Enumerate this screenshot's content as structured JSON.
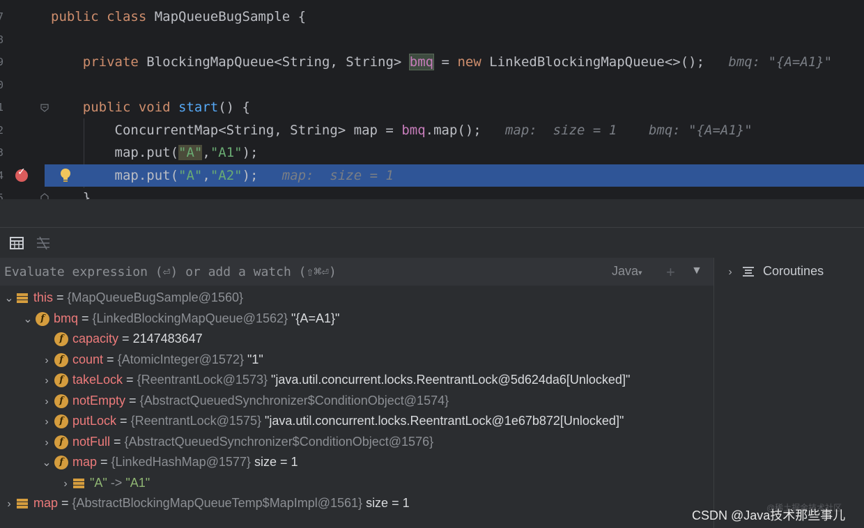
{
  "editor": {
    "lines": [
      {
        "num": "7",
        "parts": [
          {
            "t": "public class ",
            "c": "kw"
          },
          {
            "t": "MapQueueBugSample {",
            "c": ""
          }
        ]
      },
      {
        "num": "8",
        "parts": []
      },
      {
        "num": "9",
        "parts": [
          {
            "t": "    private ",
            "c": "kw"
          },
          {
            "t": "BlockingMapQueue<String, String> ",
            "c": ""
          },
          {
            "t": "bmq",
            "c": "fld box"
          },
          {
            "t": " = ",
            "c": ""
          },
          {
            "t": "new ",
            "c": "kw"
          },
          {
            "t": "LinkedBlockingMapQueue<>();",
            "c": ""
          },
          {
            "t": "   bmq: \"{A=A1}\"",
            "c": "hint"
          }
        ]
      },
      {
        "num": "0",
        "parts": []
      },
      {
        "num": "1",
        "parts": [
          {
            "t": "    public void ",
            "c": "kw"
          },
          {
            "t": "start",
            "c": "fn"
          },
          {
            "t": "() {",
            "c": ""
          }
        ]
      },
      {
        "num": "2",
        "parts": [
          {
            "t": "        ConcurrentMap<String, String> map = ",
            "c": ""
          },
          {
            "t": "bmq",
            "c": "fld"
          },
          {
            "t": ".map();",
            "c": ""
          },
          {
            "t": "   map:  size = 1    bmq: \"{A=A1}\"",
            "c": "hint"
          }
        ]
      },
      {
        "num": "3",
        "parts": [
          {
            "t": "        map.put(",
            "c": ""
          },
          {
            "t": "\"A\"",
            "c": "str hl"
          },
          {
            "t": ",",
            "c": ""
          },
          {
            "t": "\"A1\"",
            "c": "str"
          },
          {
            "t": ");",
            "c": ""
          }
        ]
      },
      {
        "num": "4",
        "parts": [
          {
            "t": "        map.put(",
            "c": ""
          },
          {
            "t": "\"A\"",
            "c": "str"
          },
          {
            "t": ",",
            "c": ""
          },
          {
            "t": "\"A2\"",
            "c": "str"
          },
          {
            "t": ");",
            "c": ""
          },
          {
            "t": "   map:  size = 1",
            "c": "hint"
          }
        ]
      },
      {
        "num": "5",
        "parts": [
          {
            "t": "    }",
            "c": ""
          }
        ]
      }
    ],
    "current_line_index": 7
  },
  "debug": {
    "eval_placeholder": "Evaluate expression (⏎) or add a watch (⇧⌘⏎)",
    "language": "Java",
    "coroutines_label": "Coroutines",
    "variables": [
      {
        "indent": 0,
        "chevron": "⌄",
        "icon": "obj",
        "name": "this",
        "type": "{MapQueueBugSample@1560}",
        "value": ""
      },
      {
        "indent": 1,
        "chevron": "⌄",
        "icon": "f",
        "name": "bmq",
        "type": "{LinkedBlockingMapQueue@1562}",
        "value": "\"{A=A1}\""
      },
      {
        "indent": 2,
        "chevron": "",
        "icon": "f",
        "name": "capacity",
        "type": "",
        "value": "2147483647"
      },
      {
        "indent": 2,
        "chevron": "›",
        "icon": "f",
        "name": "count",
        "type": "{AtomicInteger@1572}",
        "value": "\"1\""
      },
      {
        "indent": 2,
        "chevron": "›",
        "icon": "f",
        "name": "takeLock",
        "type": "{ReentrantLock@1573}",
        "value": "\"java.util.concurrent.locks.ReentrantLock@5d624da6[Unlocked]\""
      },
      {
        "indent": 2,
        "chevron": "›",
        "icon": "f",
        "name": "notEmpty",
        "type": "{AbstractQueuedSynchronizer$ConditionObject@1574}",
        "value": ""
      },
      {
        "indent": 2,
        "chevron": "›",
        "icon": "f",
        "name": "putLock",
        "type": "{ReentrantLock@1575}",
        "value": "\"java.util.concurrent.locks.ReentrantLock@1e67b872[Unlocked]\""
      },
      {
        "indent": 2,
        "chevron": "›",
        "icon": "f",
        "name": "notFull",
        "type": "{AbstractQueuedSynchronizer$ConditionObject@1576}",
        "value": ""
      },
      {
        "indent": 2,
        "chevron": "⌄",
        "icon": "f",
        "name": "map",
        "type": "{LinkedHashMap@1577}",
        "value": " size = 1"
      },
      {
        "indent": 3,
        "chevron": "›",
        "icon": "obj",
        "name": "",
        "type": "",
        "value": "",
        "entry_key": "\"A\"",
        "entry_arrow": "->",
        "entry_val": "\"A1\""
      },
      {
        "indent": 0,
        "chevron": "›",
        "icon": "obj",
        "name": "map",
        "type": "{AbstractBlockingMapQueueTemp$MapImpl@1561}",
        "value": " size = 1"
      }
    ]
  },
  "watermark": "CSDN @Java技术那些事儿",
  "watermark_faint": "@稀土掘金技术社区",
  "colors": {
    "current_line": "#2f5597",
    "field_badge": "#d59d3e",
    "breakpoint": "#db5c5c"
  }
}
